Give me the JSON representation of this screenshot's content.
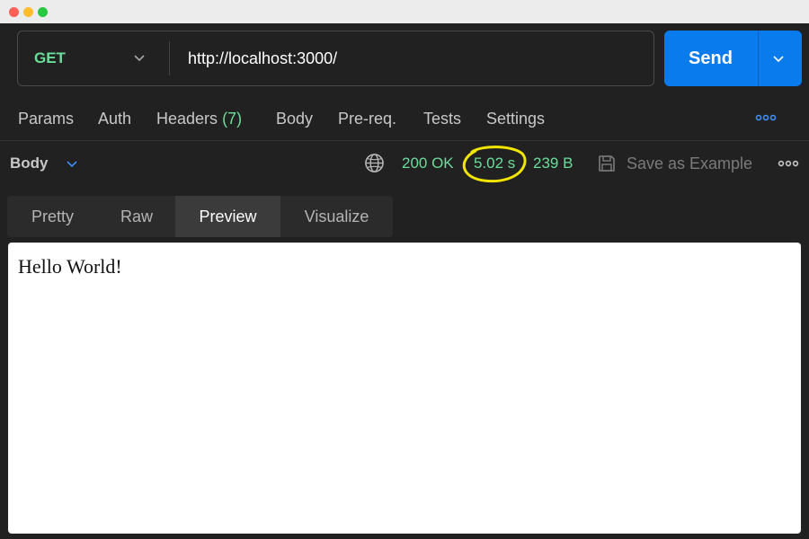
{
  "request": {
    "method": "GET",
    "url": "http://localhost:3000/",
    "send_label": "Send"
  },
  "tabs": [
    {
      "label": "Params"
    },
    {
      "label": "Auth"
    },
    {
      "label": "Headers",
      "count": "(7)"
    },
    {
      "label": "Body"
    },
    {
      "label": "Pre-req."
    },
    {
      "label": "Tests"
    },
    {
      "label": "Settings"
    }
  ],
  "response": {
    "body_label": "Body",
    "status": "200 OK",
    "time": "5.02 s",
    "size": "239 B",
    "save_label": "Save as Example"
  },
  "view_tabs": [
    {
      "label": "Pretty"
    },
    {
      "label": "Raw"
    },
    {
      "label": "Preview",
      "active": true
    },
    {
      "label": "Visualize"
    }
  ],
  "preview_text": "Hello World!",
  "colors": {
    "accent": "#097bed",
    "success": "#6bdd9a",
    "highlight": "#f2e600",
    "background": "#212121"
  },
  "icons": {
    "method_dropdown": "chevron-down-icon",
    "send_dropdown": "chevron-down-icon",
    "globe": "globe-icon",
    "save": "save-icon",
    "more": "more-horizontal-icon"
  }
}
